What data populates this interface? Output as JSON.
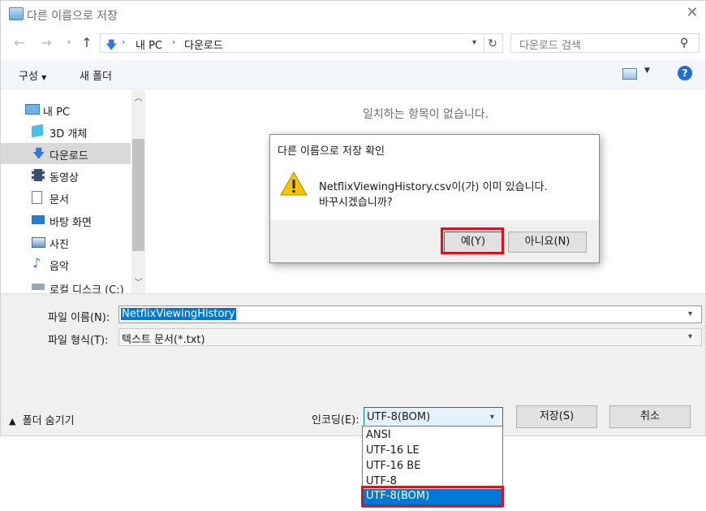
{
  "window": {
    "title": "다른 이름으로 저장"
  },
  "address": {
    "crumbs": [
      "내 PC",
      "다운로드"
    ],
    "search_placeholder": "다운로드 검색"
  },
  "toolbar": {
    "organize": "구성",
    "new_folder": "새 폴더"
  },
  "nav": {
    "items": [
      {
        "label": "내 PC",
        "icon": "pc-icon"
      },
      {
        "label": "3D 개체",
        "icon": "cube-icon"
      },
      {
        "label": "다운로드",
        "icon": "download-icon",
        "selected": true
      },
      {
        "label": "동영상",
        "icon": "video-icon"
      },
      {
        "label": "문서",
        "icon": "document-icon"
      },
      {
        "label": "바탕 화면",
        "icon": "desktop-icon"
      },
      {
        "label": "사진",
        "icon": "picture-icon"
      },
      {
        "label": "음악",
        "icon": "music-icon"
      },
      {
        "label": "로컬 디스크 (C:)",
        "icon": "disk-icon"
      }
    ]
  },
  "content": {
    "empty_message": "일치하는 항목이 없습니다."
  },
  "form": {
    "filename_label": "파일 이름(N):",
    "filename_value": "NetflixViewingHistory",
    "filetype_label": "파일 형식(T):",
    "filetype_value": "텍스트 문서(*.txt)",
    "hide_folders": "폴더 숨기기",
    "encoding_label": "인코딩(E):",
    "encoding_value": "UTF-8(BOM)",
    "save": "저장(S)",
    "cancel": "취소"
  },
  "encoding_options": [
    "ANSI",
    "UTF-16 LE",
    "UTF-16 BE",
    "UTF-8",
    "UTF-8(BOM)"
  ],
  "dialog": {
    "title": "다른 이름으로 저장 확인",
    "message_line1": "NetflixViewingHistory.csv이(가) 이미 있습니다.",
    "message_line2": "바꾸시겠습니까?",
    "yes": "예(Y)",
    "no": "아니요(N)"
  },
  "colors": {
    "accent": "#0078d7",
    "highlight": "#e0101b",
    "warning": "#f5c400"
  }
}
